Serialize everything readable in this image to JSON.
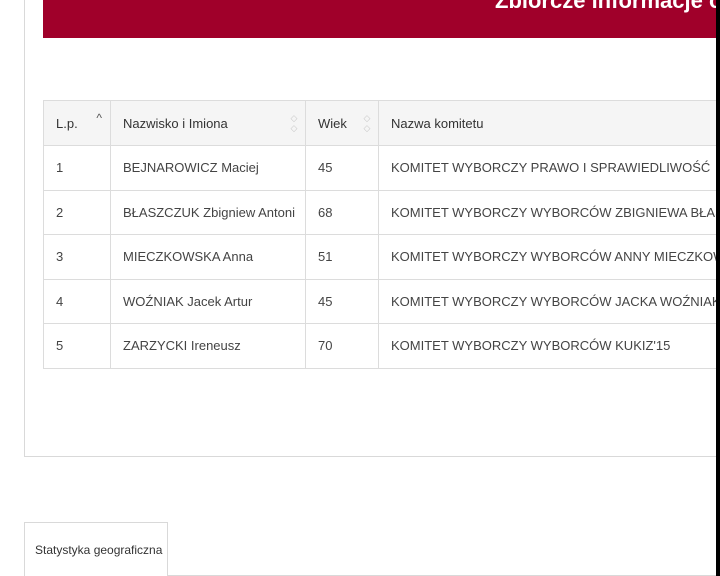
{
  "banner": {
    "title": "Zbiorcze informacje o kand"
  },
  "table": {
    "headers": {
      "lp": "L.p.",
      "name": "Nazwisko i Imiona",
      "age": "Wiek",
      "committee": "Nazwa komitetu"
    },
    "rows": [
      {
        "lp": "1",
        "name": "BEJNAROWICZ Maciej",
        "age": "45",
        "committee": "KOMITET WYBORCZY PRAWO I SPRAWIEDLIWOŚĆ"
      },
      {
        "lp": "2",
        "name": "BŁASZCZUK Zbigniew Antoni",
        "age": "68",
        "committee": "KOMITET WYBORCZY WYBORCÓW ZBIGNIEWA BŁASZCZUKA „N"
      },
      {
        "lp": "3",
        "name": "MIECZKOWSKA Anna",
        "age": "51",
        "committee": "KOMITET WYBORCZY WYBORCÓW ANNY MIECZKOWSKIEJ \"KO"
      },
      {
        "lp": "4",
        "name": "WOŹNIAK Jacek Artur",
        "age": "45",
        "committee": "KOMITET WYBORCZY WYBORCÓW JACKA WOŹNIAKA"
      },
      {
        "lp": "5",
        "name": "ZARZYCKI Ireneusz",
        "age": "70",
        "committee": "KOMITET WYBORCZY WYBORCÓW KUKIZ'15"
      }
    ]
  },
  "tabs": {
    "geo_label": "Statystyka geograficzna"
  },
  "colors": {
    "brand": "#a0002a"
  }
}
